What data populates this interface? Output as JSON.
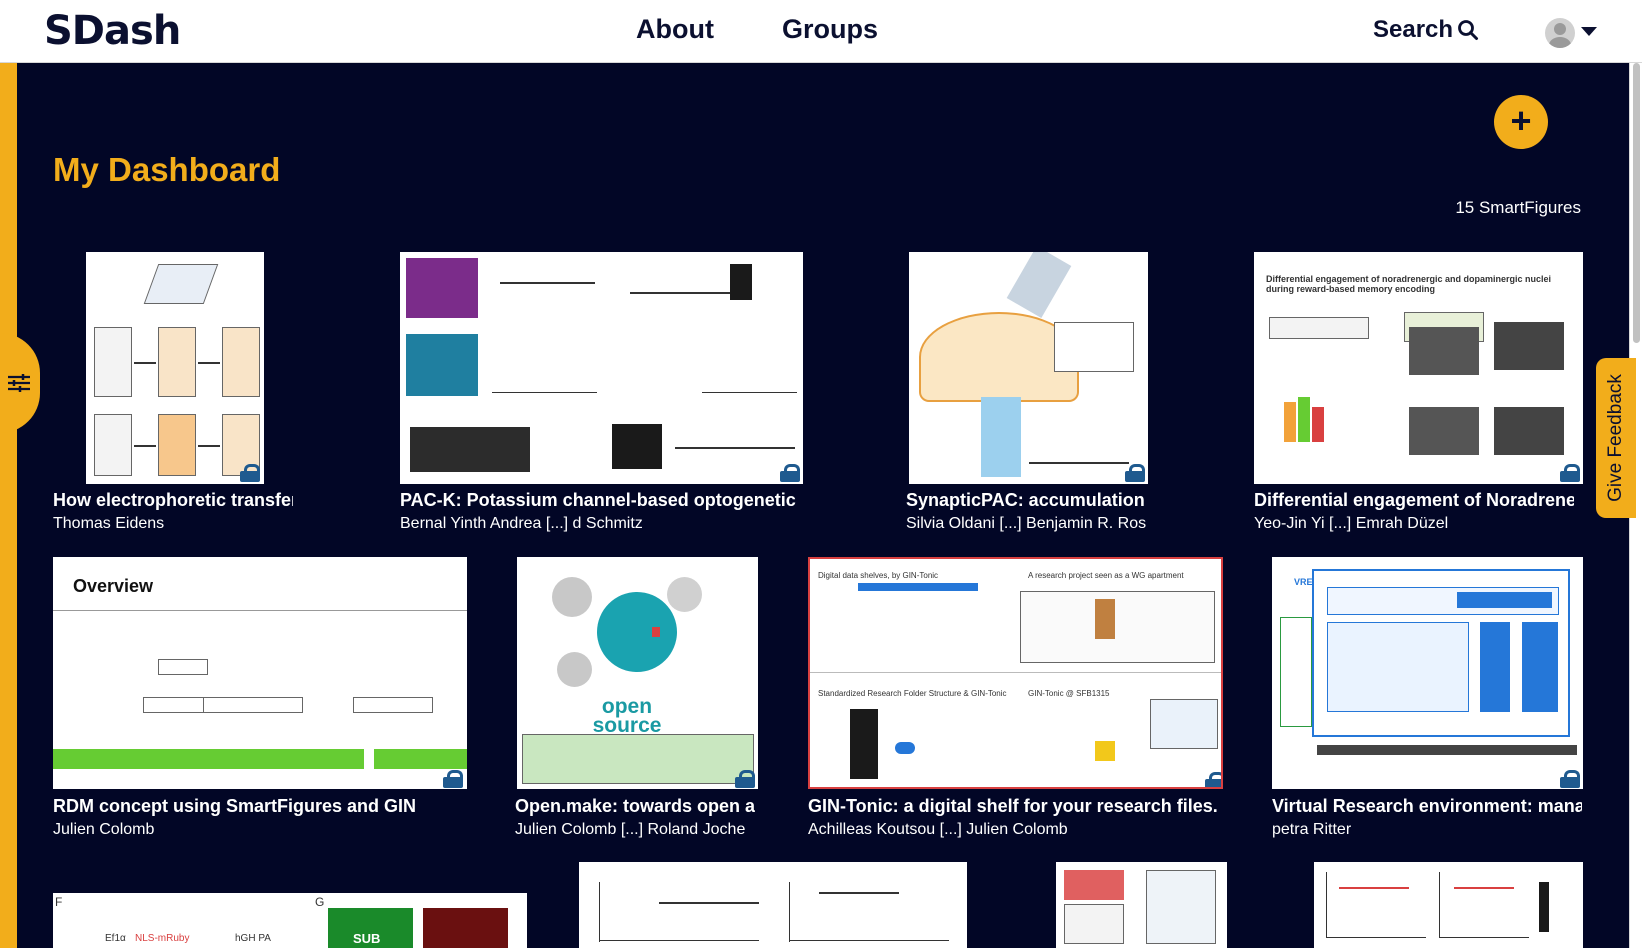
{
  "header": {
    "logo": "SDash",
    "nav": [
      {
        "label": "About"
      },
      {
        "label": "Groups"
      }
    ],
    "search_label": "Search"
  },
  "page": {
    "title": "My Dashboard",
    "count_label": "15 SmartFigures",
    "add_button_label": "+",
    "feedback_label": "Give Feedback"
  },
  "cards": [
    {
      "title": "How electrophoretic transfer",
      "author": "Thomas Eidens"
    },
    {
      "title": "PAC-K: Potassium channel-based optogenetic s",
      "author": "Bernal Yinth Andrea [...] d Schmitz"
    },
    {
      "title": "SynapticPAC: accumulation c",
      "author": "Silvia Oldani [...] Benjamin R. Rost"
    },
    {
      "title": "Differential engagement of Noradrener",
      "author": "Yeo-Jin Yi [...] Emrah Düzel"
    },
    {
      "title": "RDM concept using SmartFigures and GIN",
      "author": "Julien Colomb"
    },
    {
      "title": "Open.make: towards open an",
      "author": "Julien Colomb [...] Roland Joche"
    },
    {
      "title": "GIN-Tonic: a digital shelf for your research files.",
      "author": "Achilleas Koutsou [...] Julien Colomb"
    },
    {
      "title": "Virtual Research environment: manag",
      "author": "petra Ritter"
    }
  ],
  "thumb_text": {
    "differential_heading": "Differential engagement of noradrenergic and dopaminergic nuclei during reward-based memory encoding",
    "overview": "Overview",
    "open_source": "open source hardware",
    "gin_heading_1": "Digital data shelves, by GIN-Tonic",
    "gin_heading_2": "A research project seen as a WG apartment",
    "gin_heading_3": "Standardized Research Folder Structure & GIN-Tonic",
    "gin_heading_4": "GIN-Tonic @ SFB1315",
    "vre": "VRE",
    "bottom_labels": [
      "F",
      "G",
      "Ef1α",
      "NLS-mRuby",
      "hGH PA",
      "SUB"
    ]
  }
}
